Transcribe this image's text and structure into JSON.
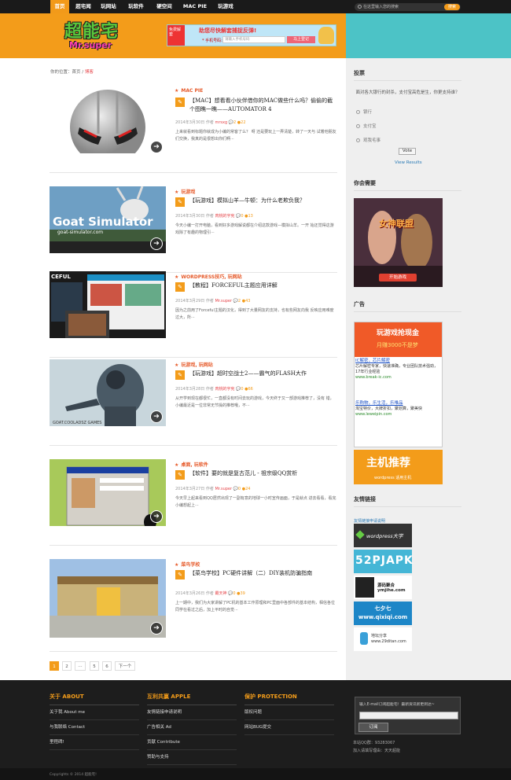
{
  "nav": {
    "items": [
      "首页",
      "超宅闻",
      "玩网站",
      "玩软件",
      "硬空间",
      "MAC PIE",
      "玩游戏"
    ],
    "search_placeholder": "在这里输入您的搜索",
    "search_button": "搜索"
  },
  "header": {
    "logo_cn": "超能宅",
    "logo_en": "Mr.super",
    "banner_title": "助您尽快解套捕捉反弹!",
    "banner_left": "免费解套",
    "banner_phone_label": "* 手机号码:",
    "banner_phone_placeholder": "请输入手机号码",
    "banner_go": "马上登记"
  },
  "breadcrumb": {
    "prefix": "你的位置：",
    "home": "首页",
    "sep": " / ",
    "current": "博客"
  },
  "posts": [
    {
      "category": "MAC PIE",
      "title": "【MAC】想看看小伙伴借你的MAC做些什么吗？偷偷的截个图瞧一瞧——AUTOMATOR 4",
      "date": "2014年3月30日",
      "author_label": "作者",
      "author": "mrsxg",
      "comments": "2",
      "views": "22",
      "excerpt": "上来就看到标题你就成为小编的常客了么？ 呀 还是要玩上一弄清楚，转了一天与 试着他朋友们交换，我真的是很想出你们啊⋯"
    },
    {
      "category": "玩游戏",
      "title": "【玩游戏】模拟山羊—牛顿：为什么老欺负我？",
      "date": "2014年3月30日",
      "author_label": "作者",
      "author": "肉桃的宇宪",
      "comments": "0",
      "views": "13",
      "excerpt": "今天小编一打开电脑，看到好多游戏解说都在介绍这款游戏—模拟山羊。一开 始还觉得这游戏除了有趣的物理引⋯"
    },
    {
      "category": "WORDPRESS技巧, 玩网站",
      "title": "【教程】FORCEFUL主题应用详解",
      "date": "2014年3月29日",
      "author_label": "作者",
      "author": "Mr.super",
      "comments": "2",
      "views": "43",
      "excerpt": " 因为之前用了Forceful主题的汉化，得到了大量网友的支持，也有些网友向我 反映应用难度过大，所⋯"
    },
    {
      "category": "玩游戏, 玩网站",
      "title": "【玩游戏】超时空战士2——霸气的FLASH大作",
      "date": "2014年3月28日",
      "author_label": "作者",
      "author": "肉桃的宇宪",
      "comments": "0",
      "views": "66",
      "excerpt": "从开学到现在都很忙，一直都没有时间去玩的游戏，今天终于又一部游戏推荐了，没有 错，小编最近是一位非常无节操的推荐哦，不⋯"
    },
    {
      "category": "桌面, 玩软件",
      "title": "【软件】要的就是复古范儿 - 祖宗级QQ赏析",
      "date": "2014年3月27日",
      "author_label": "作者",
      "author": "Mr.super",
      "comments": "0",
      "views": "24",
      "excerpt": " 今天早上起来看到QQ居然出现了一副有意的地球一小时宣传画面，于是就点 进去看看，看完小编想起上⋯"
    },
    {
      "category": "菜鸟学校",
      "title": "【菜鸟学校】PC硬件讲解（二）DIY装机防骗指南",
      "date": "2014年3月26日",
      "author_label": "作者",
      "author": "霸天神",
      "comments": "0",
      "views": "39",
      "excerpt": "上一期中，我们为大家讲解了PC机的基本工作原理和PC里面中各部件的基本结构，相信各位同学在看过之后，加上平时的自觉⋯"
    }
  ],
  "pager": [
    "1",
    "2",
    "⋯",
    "5",
    "6",
    "下一个"
  ],
  "sidebar": {
    "poll_title": "投票",
    "poll_question": "面对各大银行的封杀，支付宝高危是生，你更支持谁？",
    "poll_options": [
      "银行",
      "支付宝",
      "观我毛事"
    ],
    "vote_label": "Vote",
    "view_results": "View Results",
    "need_title": "你会需要",
    "game_ad_title": "女神联盟",
    "game_ad_btn": "开始游戏",
    "ad_title": "广告",
    "ad2_head": "玩游戏抢现金",
    "ad2_sub": "月赚3000不是梦",
    "ad2_links": [
      {
        "t": "IC解密，芯片解密",
        "d": "芯片解密专家，快速准确，专业团队技术强劲，17年行业经验",
        "u": "www.break-ic.com"
      },
      {
        "t": "乐购物，乐生活，乐唯品",
        "d": "淘宝特价，大牌折扣，聚划算，聚美快",
        "u": "www.leweipin.com"
      }
    ],
    "ad3_title": "主机推荐",
    "ad3_sub": "wordpress 适用主机",
    "friends_title": "友情链接",
    "friends_apply": "友情链接申请说明",
    "flinks": [
      "wordpress大学",
      "52PJAPK",
      "源码聚合 ymjihe.com",
      "七夕七 www.qixiqi.com",
      "地坛分享 www.29ditan.com"
    ]
  },
  "footer": {
    "cols": [
      {
        "title": "关于 ABOUT",
        "items": [
          "关于我 About me",
          "与我联络 Contact",
          "里程碑!"
        ]
      },
      {
        "title": "互利共赢 APPLE",
        "items": [
          "友情链接申请说明",
          "广告相关 Ad",
          "贡献 Contribute",
          "赞助与支持"
        ]
      },
      {
        "title": "保护 PROTECTION",
        "items": [
          "版权问题",
          "网站BUG提交"
        ]
      }
    ],
    "subscribe_tip": "输入E-mail订阅超能宅！最新资讯新更到达~",
    "subscribe_btn": "订阅",
    "qq": "本站QQ群：93283067",
    "qq2": "加入请填写理由：天天超能",
    "copyright": "Copyrights © 2014 超能宅!"
  }
}
